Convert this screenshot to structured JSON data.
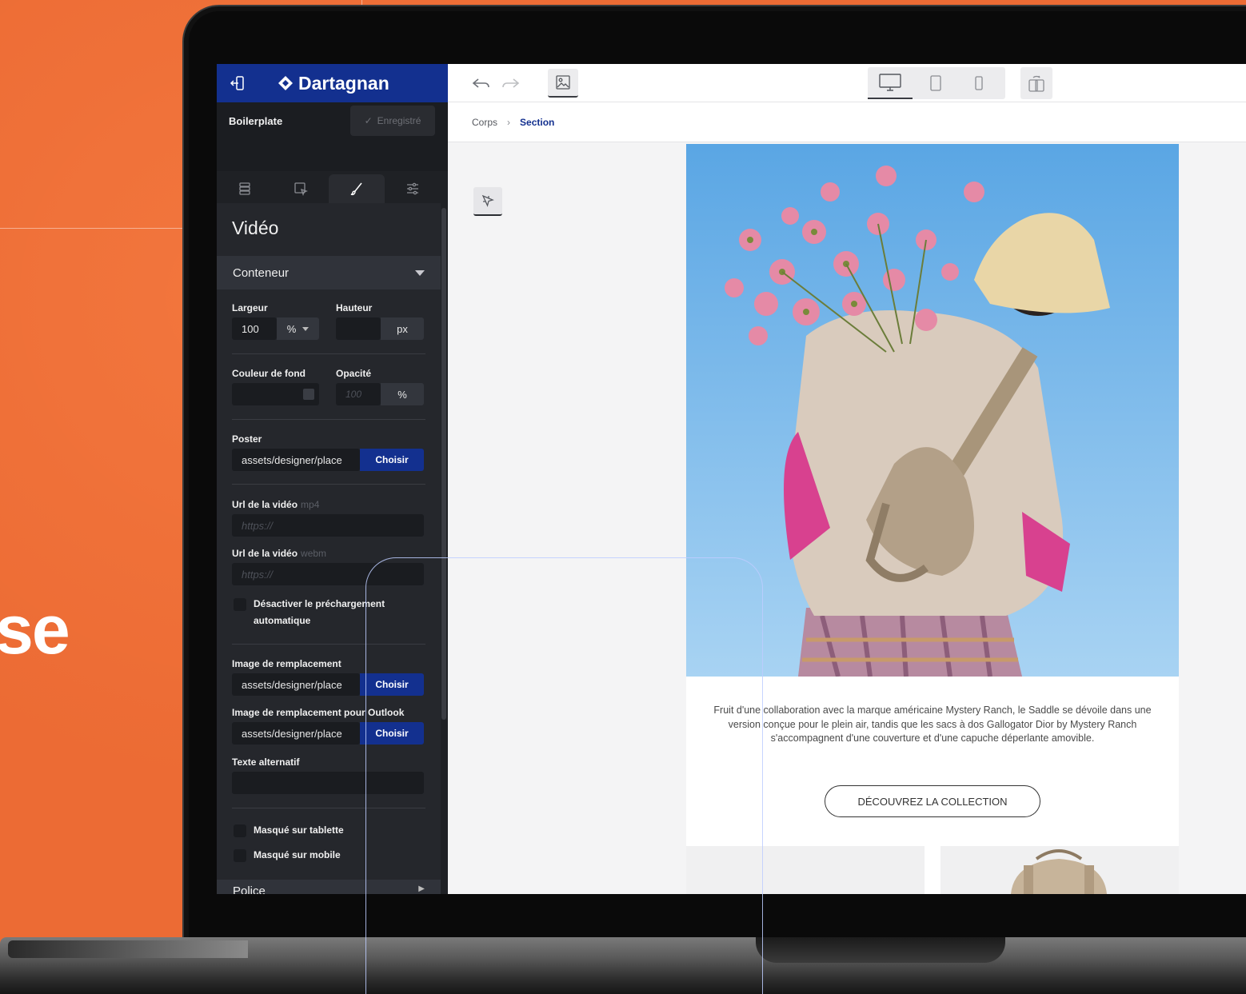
{
  "background": {
    "hero_text": "se",
    "accent": "#ec6b34"
  },
  "app": {
    "brand": "Dartagnan",
    "project_name": "Boilerplate",
    "saved_label": "Enregistré",
    "brand_color": "#13308f"
  },
  "sidebar": {
    "tabs": [
      {
        "icon": "layers-icon",
        "active": false
      },
      {
        "icon": "select-element-icon",
        "active": false
      },
      {
        "icon": "brush-icon",
        "active": true
      },
      {
        "icon": "settings-sliders-icon",
        "active": false
      }
    ],
    "panel_title": "Vidéo",
    "section_container": "Conteneur",
    "width_label": "Largeur",
    "width_value": "100",
    "width_unit": "%",
    "height_label": "Hauteur",
    "height_value": "",
    "height_unit": "px",
    "bg_color_label": "Couleur de fond",
    "opacity_label": "Opacité",
    "opacity_placeholder": "100",
    "opacity_unit": "%",
    "poster_label": "Poster",
    "poster_value": "assets/designer/place",
    "choose_label": "Choisir",
    "video_url_label": "Url de la vidéo",
    "mp4_hint": "mp4",
    "webm_hint": "webm",
    "url_placeholder": "https://",
    "disable_preload": "Désactiver le préchargement automatique",
    "replacement_image_label": "Image de remplacement",
    "replacement_image_value": "assets/designer/place",
    "outlook_image_label": "Image de remplacement pour Outlook",
    "outlook_image_value": "assets/designer/place",
    "alt_text_label": "Texte alternatif",
    "alt_text_value": "",
    "hidden_tablet": "Masqué sur tablette",
    "hidden_mobile": "Masqué sur mobile",
    "next_section": "Police"
  },
  "breadcrumb": {
    "root": "Corps",
    "current": "Section"
  },
  "email": {
    "body_text": "Fruit d'une collaboration avec la marque américaine Mystery Ranch, le Saddle se dévoile dans une version conçue pour le plein air, tandis que les sacs à dos Gallogator Dior by Mystery Ranch s'accompagnent d'une couverture et d'une capuche déperlante amovible.",
    "cta_label": "DÉCOUVREZ LA COLLECTION"
  }
}
